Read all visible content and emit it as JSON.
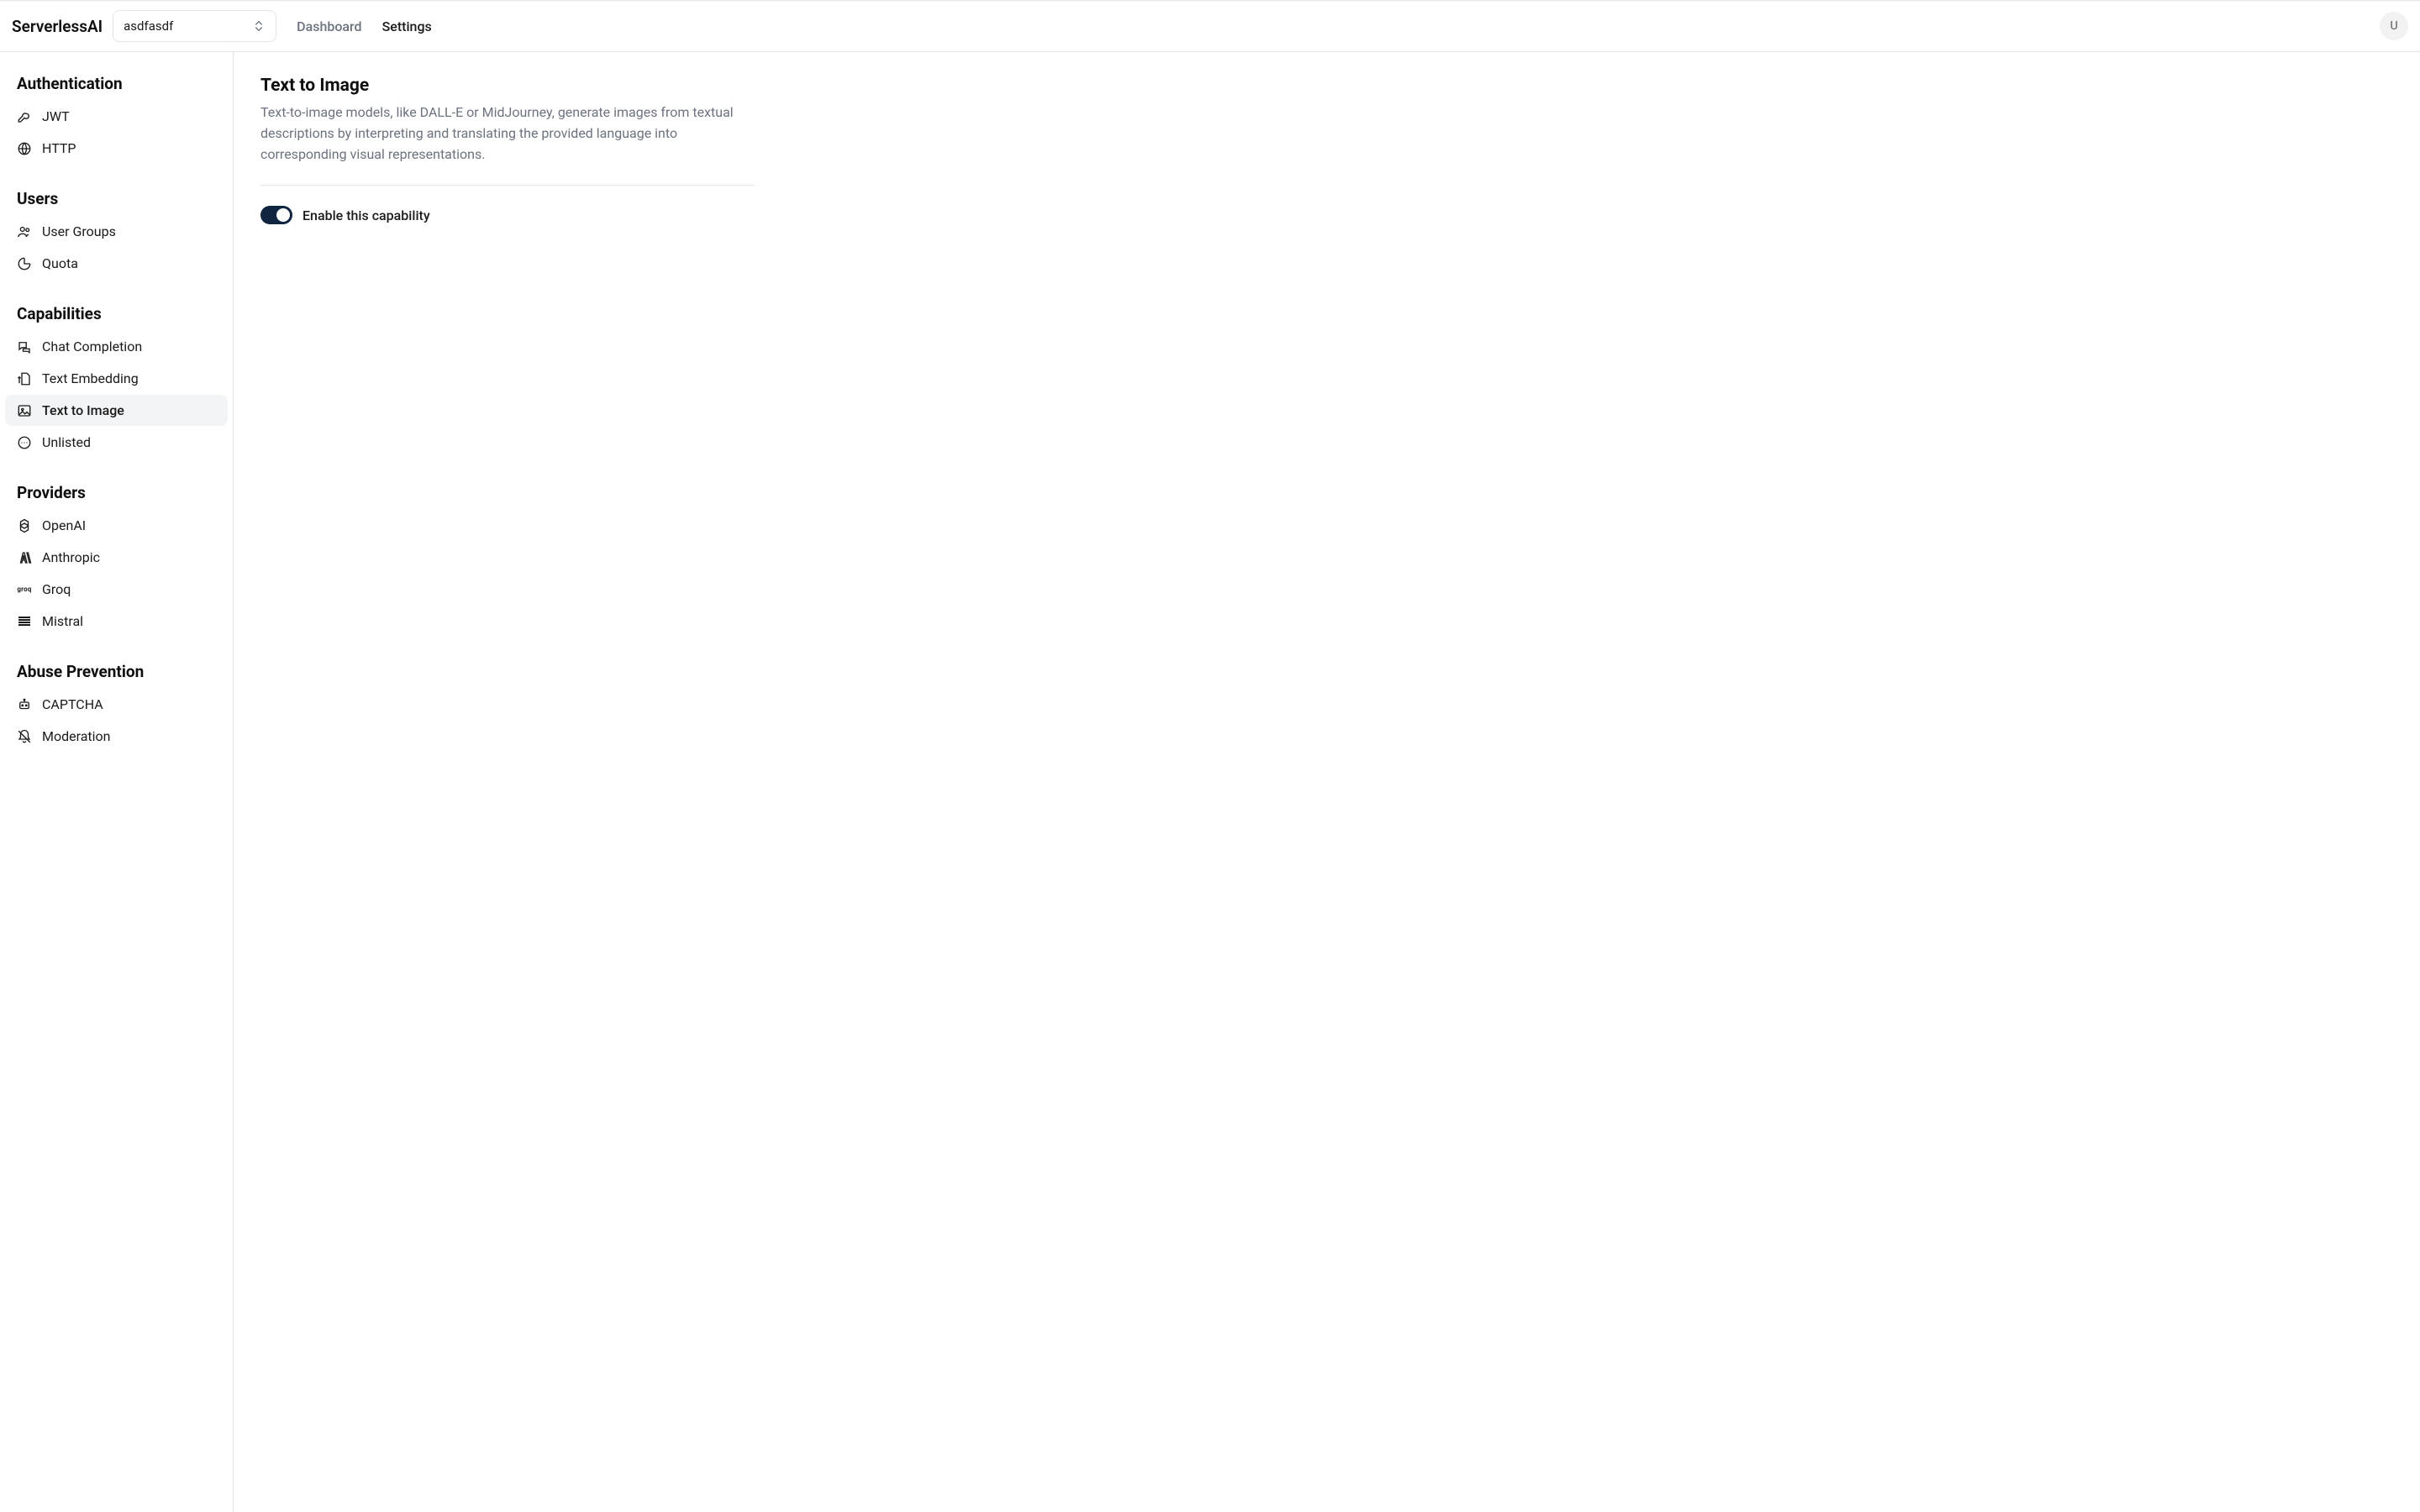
{
  "header": {
    "brand": "ServerlessAI",
    "project": "asdfasdf",
    "nav": {
      "dashboard": "Dashboard",
      "settings": "Settings"
    },
    "avatar_letter": "U"
  },
  "sidebar": {
    "sections": [
      {
        "title": "Authentication",
        "items": [
          {
            "label": "JWT"
          },
          {
            "label": "HTTP"
          }
        ]
      },
      {
        "title": "Users",
        "items": [
          {
            "label": "User Groups"
          },
          {
            "label": "Quota"
          }
        ]
      },
      {
        "title": "Capabilities",
        "items": [
          {
            "label": "Chat Completion"
          },
          {
            "label": "Text Embedding"
          },
          {
            "label": "Text to Image"
          },
          {
            "label": "Unlisted"
          }
        ]
      },
      {
        "title": "Providers",
        "items": [
          {
            "label": "OpenAI"
          },
          {
            "label": "Anthropic"
          },
          {
            "label": "Groq"
          },
          {
            "label": "Mistral"
          }
        ]
      },
      {
        "title": "Abuse Prevention",
        "items": [
          {
            "label": "CAPTCHA"
          },
          {
            "label": "Moderation"
          }
        ]
      }
    ]
  },
  "main": {
    "title": "Text to Image",
    "description": "Text-to-image models, like DALL-E or MidJourney, generate images from textual descriptions by interpreting and translating the provided language into corresponding visual representations.",
    "toggle_label": "Enable this capability",
    "toggle_on": true
  }
}
